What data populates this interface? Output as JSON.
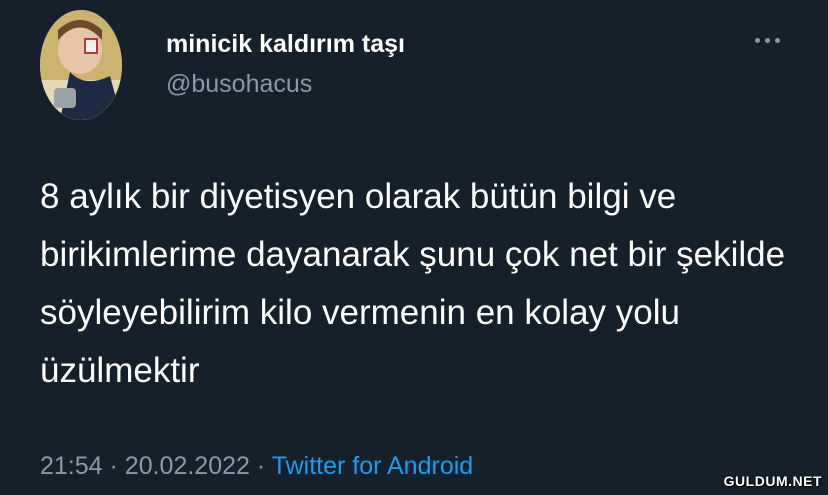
{
  "user": {
    "display_name": "minicik kaldırım taşı",
    "handle": "@busohacus"
  },
  "tweet": {
    "text": "8 aylık bir diyetisyen olarak bütün bilgi ve birikimlerime dayanarak şunu çok net bir şekilde söyleyebilirim kilo vermenin en kolay yolu üzülmektir",
    "time": "21:54",
    "date": "20.02.2022",
    "separator": "·",
    "source": "Twitter for Android"
  },
  "icons": {
    "more": "more-icon"
  },
  "watermark": "GULDUM.NET",
  "colors": {
    "background": "#15202b",
    "text": "#ffffff",
    "muted": "#8b98a5",
    "link": "#1d9bf0"
  }
}
